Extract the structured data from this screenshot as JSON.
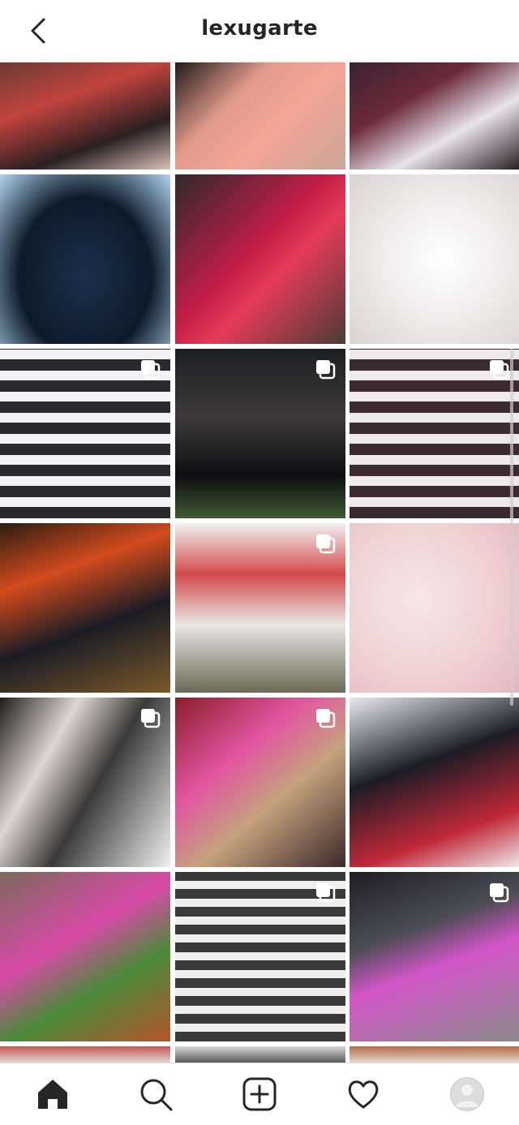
{
  "header": {
    "username": "lexugarte",
    "back_icon": "chevron-left-icon"
  },
  "grid": {
    "tiles": [
      {
        "label": "post-1",
        "bg": "linear-gradient(160deg,#6b3a35 0%,#c1443d 35%,#2a1f22 70%,#d7c3b6 100%)",
        "multi": false
      },
      {
        "label": "post-2",
        "bg": "linear-gradient(135deg,#1f1a1a 0%,#e39b8b 35%,#f4a596 60%,#caa69a 100%)",
        "multi": false
      },
      {
        "label": "post-3",
        "bg": "linear-gradient(150deg,#3b2230 0%,#6b2a3c 35%,#e8e4ea 65%,#2a1f22 100%)",
        "multi": false
      },
      {
        "label": "post-4",
        "bg": "radial-gradient(ellipse at 50% 60%,#1c2f4a 0%,#0e1a2b 55%,#b2d5ef 100%)",
        "multi": false
      },
      {
        "label": "post-5",
        "bg": "linear-gradient(135deg,#2f2a2b 0%,#c21d47 45%,#e63b58 60%,#4a3b36 100%)",
        "multi": false
      },
      {
        "label": "post-6",
        "bg": "radial-gradient(circle at 55% 50%,#ffffff 0%,#f0eeee 45%,#d9d3cf 100%)",
        "multi": false
      },
      {
        "label": "post-7",
        "bg": "repeating-linear-gradient(0deg,#2a2a2e 0px,#2a2a2e 14px,#f2f2f4 14px,#f2f2f4 26px)",
        "multi": true
      },
      {
        "label": "post-8",
        "bg": "linear-gradient(180deg,#1e1f21 0%,#3c3a3a 40%,#0e0e10 75%,#3e5b33 100%)",
        "multi": true
      },
      {
        "label": "post-9",
        "bg": "repeating-linear-gradient(0deg,#3a2b30 0px,#3a2b30 14px,#efe9ec 14px,#efe9ec 26px)",
        "multi": true
      },
      {
        "label": "post-10",
        "bg": "linear-gradient(160deg,#2b1d12 0%,#d24b1d 30%,#1a1c24 60%,#7a5a2a 100%)",
        "multi": false
      },
      {
        "label": "post-11",
        "bg": "linear-gradient(180deg,#f2f2f2 0%,#d24a4a 30%,#e9e7e4 60%,#6b6a55 100%)",
        "multi": true
      },
      {
        "label": "post-12",
        "bg": "radial-gradient(circle at 40% 45%,#f6e7e7 0%,#f0d2d2 55%,#e3b7c0 100%)",
        "multi": false
      },
      {
        "label": "post-13",
        "bg": "linear-gradient(120deg,#1e1e1e 0%,#ded6d0 30%,#3a3a3a 55%,#f0f0f0 100%)",
        "multi": true
      },
      {
        "label": "post-14",
        "bg": "linear-gradient(140deg,#8a1e2a 0%,#e255a1 35%,#c5a27d 60%,#3a2a2a 100%)",
        "multi": true
      },
      {
        "label": "post-15",
        "bg": "linear-gradient(160deg,#e9e9ef 0%,#1c1c24 40%,#c02839 75%,#efe8e8 100%)",
        "multi": false
      },
      {
        "label": "post-16",
        "bg": "linear-gradient(150deg,#7b6a5a 0%,#d84aa7 40%,#4a8a3a 65%,#b3552a 100%)",
        "multi": false
      },
      {
        "label": "post-17",
        "bg": "repeating-linear-gradient(0deg,#3a3a3a 0px,#3a3a3a 12px,#eeeeee 12px,#eeeeee 22px)",
        "multi": true
      },
      {
        "label": "post-18",
        "bg": "linear-gradient(160deg,#1e1e22 0%,#4d4d55 35%,#d256c8 55%,#8a8a8a 100%)",
        "multi": true
      },
      {
        "label": "post-19",
        "bg": "linear-gradient(180deg,#c45a54 0%,#e0d7d2 100%)",
        "multi": false
      },
      {
        "label": "post-20",
        "bg": "linear-gradient(180deg,#d7d7d7 0%,#5a5a5a 100%)",
        "multi": false
      },
      {
        "label": "post-21",
        "bg": "linear-gradient(180deg,#b36b4a 0%,#e6d6cc 100%)",
        "multi": false
      }
    ]
  },
  "tabbar": {
    "items": [
      {
        "icon": "home-icon"
      },
      {
        "icon": "search-icon"
      },
      {
        "icon": "add-post-icon"
      },
      {
        "icon": "heart-icon"
      },
      {
        "icon": "profile-avatar"
      }
    ]
  }
}
